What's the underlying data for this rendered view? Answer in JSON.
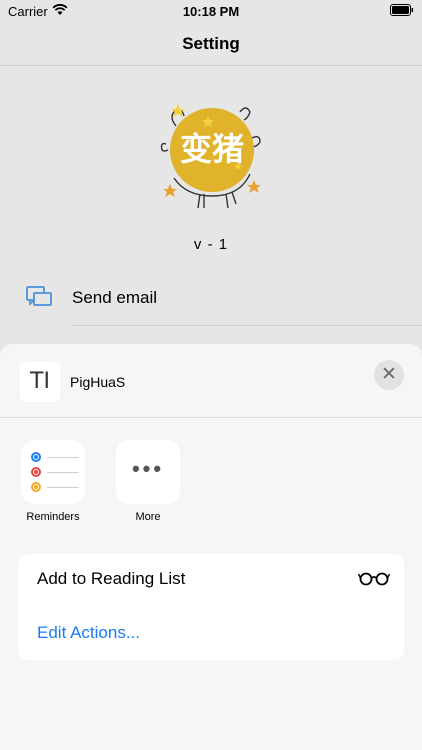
{
  "status_bar": {
    "carrier": "Carrier",
    "time": "10:18 PM"
  },
  "nav": {
    "title": "Setting"
  },
  "logo": {
    "text": "变猪",
    "accent_color": "#e0b32a"
  },
  "version": "v - 1",
  "menu": {
    "items": [
      {
        "label": "Send email",
        "icon": "chat-bubbles-icon"
      }
    ]
  },
  "share_sheet": {
    "document": {
      "icon_text": "TI",
      "title": "PigHuaS"
    },
    "apps": [
      {
        "label": "Reminders",
        "icon": "reminders-icon"
      },
      {
        "label": "More",
        "icon": "more-icon"
      }
    ],
    "actions": [
      {
        "label": "Add to Reading List",
        "icon": "glasses-icon"
      },
      {
        "label": "Edit Actions...",
        "color": "#1a7cf5"
      }
    ]
  },
  "colors": {
    "link_blue": "#1a7cf5",
    "icon_blue": "#4a90d9",
    "reminder_blue": "#1a7cf5",
    "reminder_red": "#e8453c",
    "reminder_orange": "#f5a623"
  }
}
